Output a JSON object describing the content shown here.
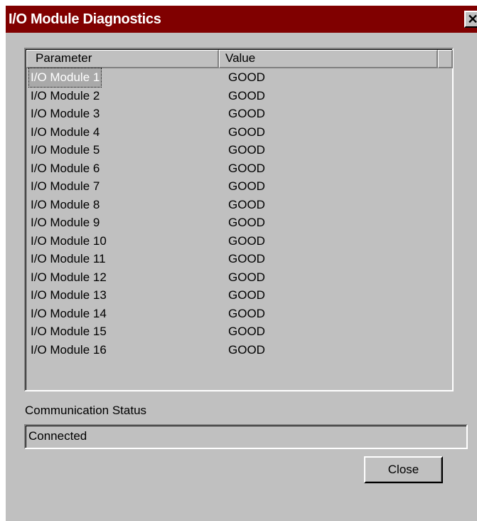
{
  "window": {
    "title": "I/O Module Diagnostics",
    "close_glyph": "✕"
  },
  "table": {
    "headers": [
      "Parameter",
      "Value"
    ],
    "rows": [
      {
        "parameter": "I/O Module 1",
        "value": "GOOD"
      },
      {
        "parameter": "I/O Module 2",
        "value": "GOOD"
      },
      {
        "parameter": "I/O Module 3",
        "value": "GOOD"
      },
      {
        "parameter": "I/O Module 4",
        "value": "GOOD"
      },
      {
        "parameter": "I/O Module 5",
        "value": "GOOD"
      },
      {
        "parameter": "I/O Module 6",
        "value": "GOOD"
      },
      {
        "parameter": "I/O Module 7",
        "value": "GOOD"
      },
      {
        "parameter": "I/O Module 8",
        "value": "GOOD"
      },
      {
        "parameter": "I/O Module 9",
        "value": "GOOD"
      },
      {
        "parameter": "I/O Module 10",
        "value": "GOOD"
      },
      {
        "parameter": "I/O Module 11",
        "value": "GOOD"
      },
      {
        "parameter": "I/O Module 12",
        "value": "GOOD"
      },
      {
        "parameter": "I/O Module 13",
        "value": "GOOD"
      },
      {
        "parameter": "I/O Module 14",
        "value": "GOOD"
      },
      {
        "parameter": "I/O Module 15",
        "value": "GOOD"
      },
      {
        "parameter": "I/O Module 16",
        "value": "GOOD"
      }
    ],
    "selected_index": 0
  },
  "communication": {
    "label": "Communication Status",
    "value": "Connected"
  },
  "buttons": {
    "close_label": "Close"
  },
  "colors": {
    "titlebar": "#800000",
    "face": "#c0c0c0"
  },
  "icons": {
    "window_close": "close-icon"
  }
}
